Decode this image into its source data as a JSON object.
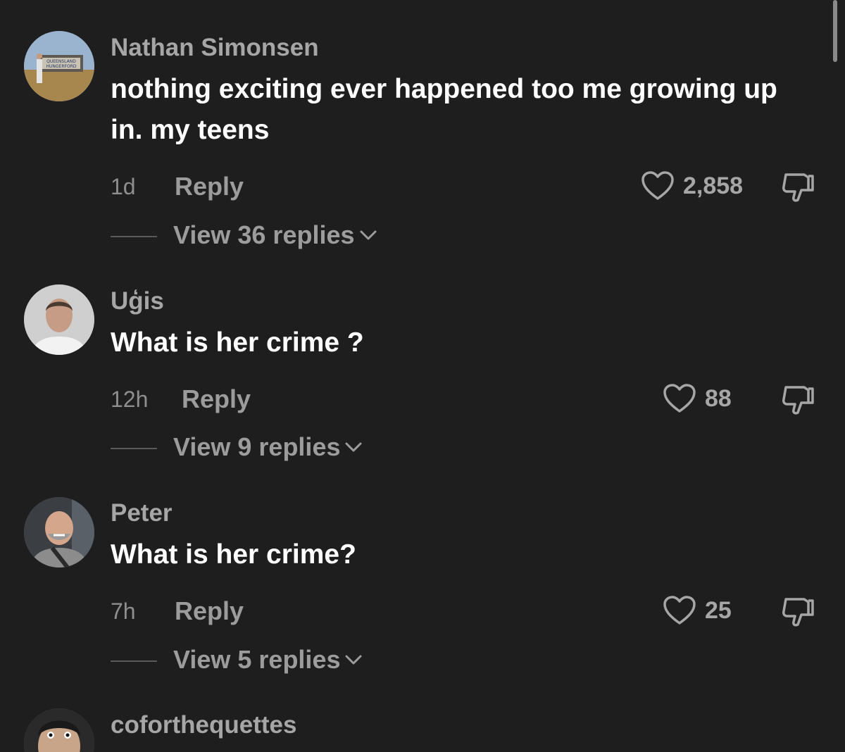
{
  "comments": [
    {
      "username": "Nathan Simonsen",
      "text": "nothing exciting ever happened too me growing up in. my teens",
      "time": "1d",
      "reply_label": "Reply",
      "likes": "2,858",
      "view_replies": "View 36 replies",
      "avatar_sign_text": [
        "QUEENSLAND",
        "HUNGERFORD"
      ]
    },
    {
      "username": "Uģis",
      "text": "What is her crime ?",
      "time": "12h",
      "reply_label": "Reply",
      "likes": "88",
      "view_replies": "View 9 replies"
    },
    {
      "username": "Peter",
      "text": "What is her crime?",
      "time": "7h",
      "reply_label": "Reply",
      "likes": "25",
      "view_replies": "View 5 replies"
    },
    {
      "username": "coforthequettes"
    }
  ],
  "icons": {
    "like": "heart-icon",
    "dislike": "thumbs-down-icon",
    "expand": "chevron-down-icon"
  },
  "colors": {
    "background": "#1e1e1e",
    "username": "#a6a6a6",
    "text": "#ffffff",
    "secondary": "#9c9c9c"
  }
}
